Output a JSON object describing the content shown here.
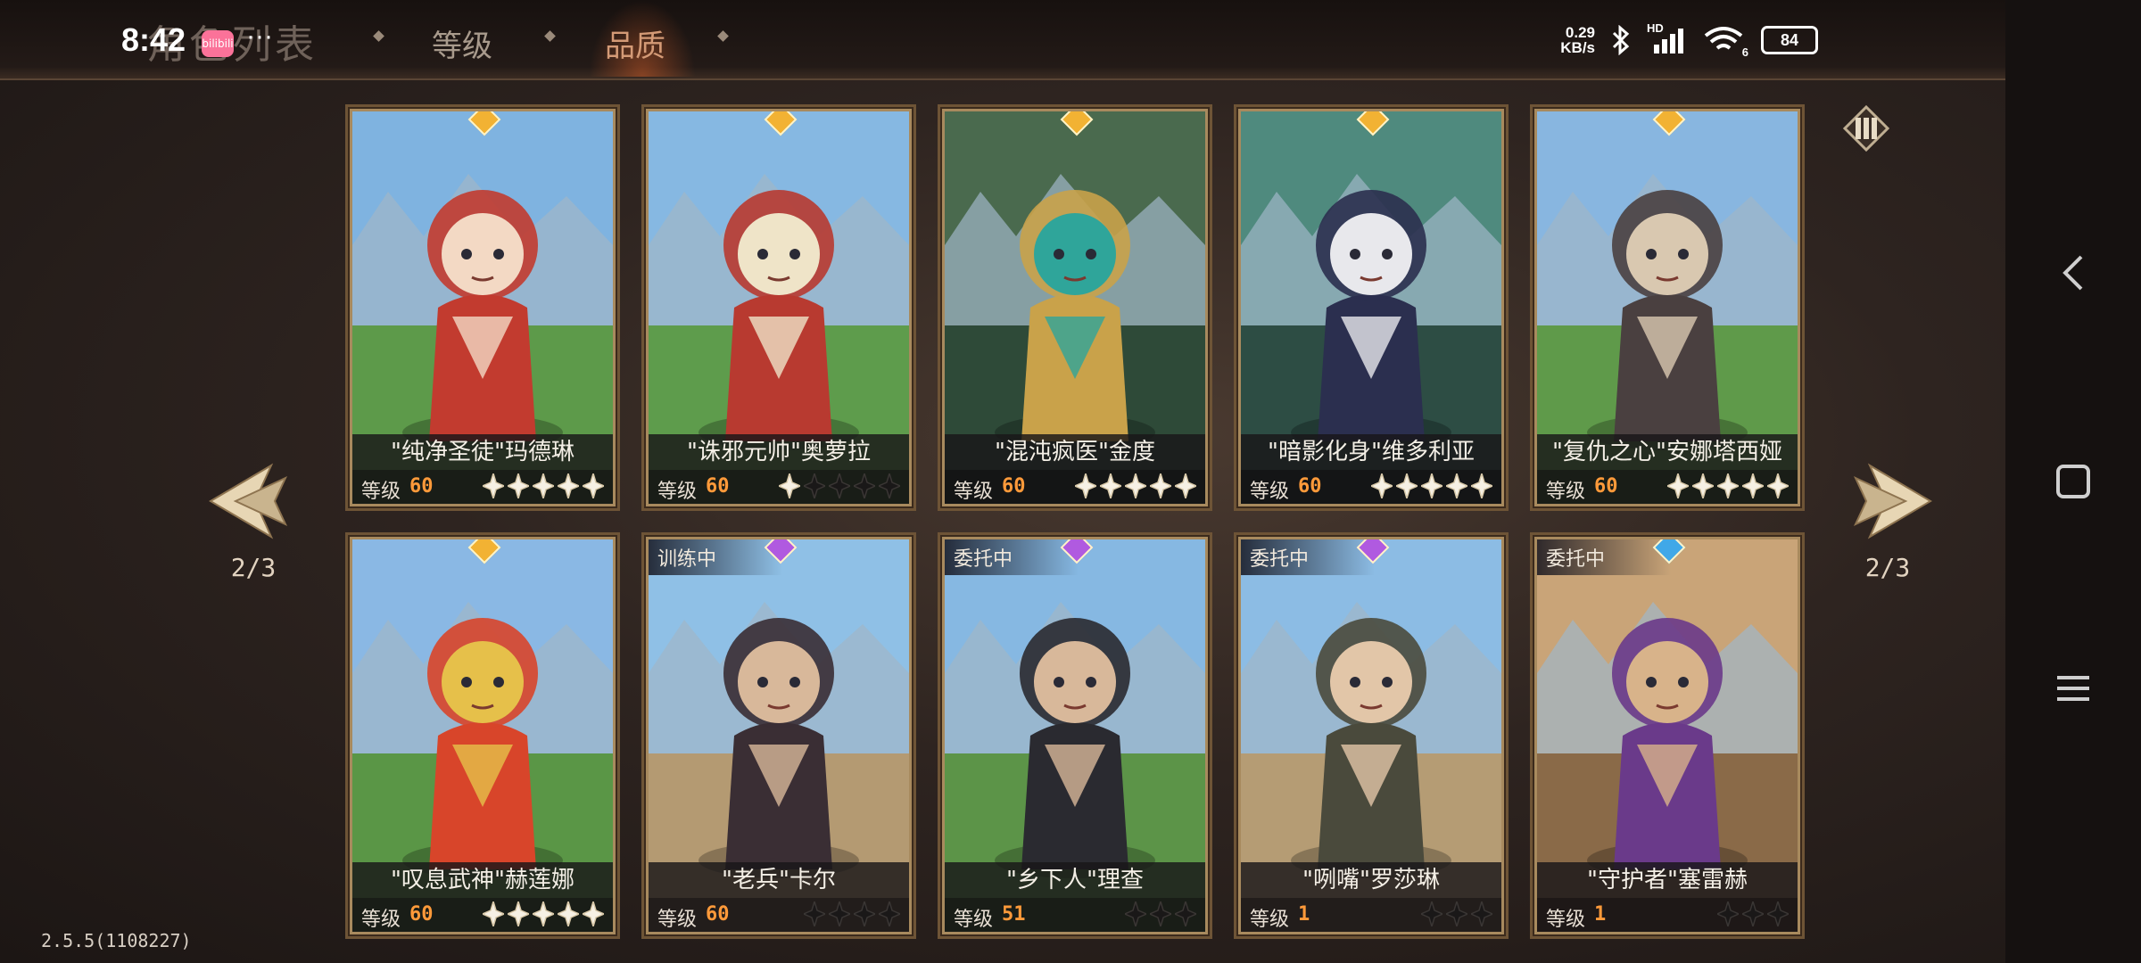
{
  "status_bar": {
    "time": "8:42",
    "app_badge": "bilibili",
    "more": "···",
    "net_speed_value": "0.29",
    "net_speed_unit": "KB/s",
    "signal_label": "HD",
    "wifi_label": "6",
    "battery": "84"
  },
  "header": {
    "title": "角色列表",
    "tabs": [
      {
        "label": "等级",
        "active": false
      },
      {
        "label": "品质",
        "active": true
      }
    ]
  },
  "pager": {
    "left": "2/3",
    "right": "2/3"
  },
  "level_label": "等级",
  "cards": [
    {
      "name": "\"纯净圣徒\"玛德琳",
      "level": "60",
      "stars_filled": 5,
      "stars_total": 5,
      "gem": "#f2b233",
      "status": "",
      "palette": [
        "#7fb3e0",
        "#5d9a4a",
        "#c23b2f",
        "#f3d9c4"
      ]
    },
    {
      "name": "\"诛邪元帅\"奥萝拉",
      "level": "60",
      "stars_filled": 1,
      "stars_total": 5,
      "gem": "#f2b233",
      "status": "",
      "palette": [
        "#86b8e2",
        "#5e9c4c",
        "#b83a30",
        "#efe4c8"
      ]
    },
    {
      "name": "\"混沌疯医\"金度",
      "level": "60",
      "stars_filled": 5,
      "stars_total": 5,
      "gem": "#f2b233",
      "status": "",
      "palette": [
        "#4a6a4e",
        "#2e4a38",
        "#c9a24a",
        "#2fa59a"
      ]
    },
    {
      "name": "\"暗影化身\"维多利亚",
      "level": "60",
      "stars_filled": 5,
      "stars_total": 5,
      "gem": "#f2b233",
      "status": "",
      "palette": [
        "#4f8a7e",
        "#2d4d44",
        "#2b2f4f",
        "#e8e8ec"
      ]
    },
    {
      "name": "\"复仇之心\"安娜塔西娅",
      "level": "60",
      "stars_filled": 5,
      "stars_total": 5,
      "gem": "#f2b233",
      "status": "",
      "palette": [
        "#88b6e0",
        "#5f9a4a",
        "#4a4040",
        "#d9c8b0"
      ]
    },
    {
      "name": "\"叹息武神\"赫莲娜",
      "level": "60",
      "stars_filled": 5,
      "stars_total": 5,
      "gem": "#f2b233",
      "status": "",
      "palette": [
        "#8ab8e4",
        "#5a9646",
        "#d8452a",
        "#e6c04a"
      ]
    },
    {
      "name": "\"老兵\"卡尔",
      "level": "60",
      "stars_filled": 0,
      "stars_total": 4,
      "gem": "#b05ae0",
      "status": "训练中",
      "palette": [
        "#8fc0e6",
        "#b49a72",
        "#3a2e34",
        "#d8b89a"
      ]
    },
    {
      "name": "\"乡下人\"理查",
      "level": "51",
      "stars_filled": 0,
      "stars_total": 3,
      "gem": "#b05ae0",
      "status": "委托中",
      "palette": [
        "#86b8e2",
        "#5c9448",
        "#2a2a30",
        "#d8b89a"
      ]
    },
    {
      "name": "\"咧嘴\"罗莎琳",
      "level": "1",
      "stars_filled": 0,
      "stars_total": 3,
      "gem": "#b05ae0",
      "status": "委托中",
      "palette": [
        "#8cbce4",
        "#b59c74",
        "#4a4a3c",
        "#e2c6a8"
      ]
    },
    {
      "name": "\"守护者\"塞雷赫",
      "level": "1",
      "stars_filled": 0,
      "stars_total": 3,
      "gem": "#40a8e8",
      "status": "委托中",
      "palette": [
        "#c9a478",
        "#8a6a48",
        "#6a3a8a",
        "#d8b38a"
      ]
    }
  ],
  "version": "2.5.5(1108227)"
}
